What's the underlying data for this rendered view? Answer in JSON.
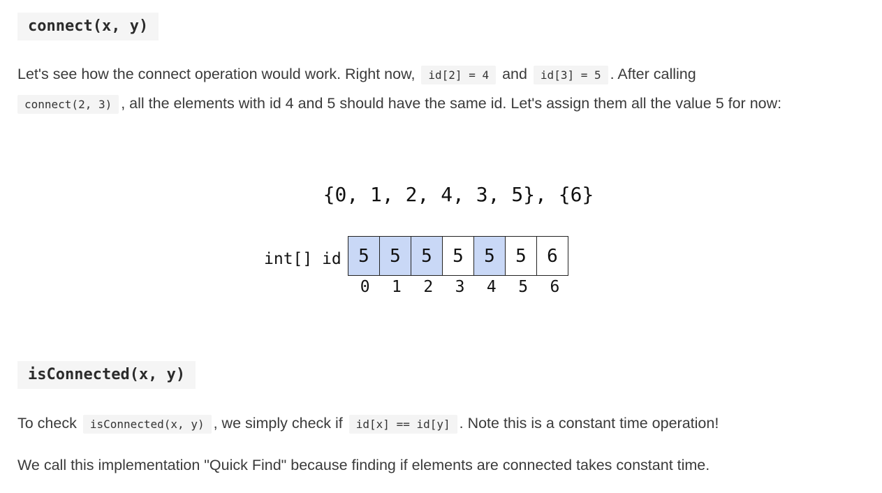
{
  "headings": {
    "connect": "connect(x, y)",
    "is_connected": "isConnected(x, y)"
  },
  "connect_paragraph": {
    "t1": "Let's see how the connect operation would work. Right now, ",
    "c1": "id[2] = 4",
    "t2": " and ",
    "c2": "id[3] = 5",
    "t3": ". After calling ",
    "c3": "connect(2, 3)",
    "t4": ", all the elements with id 4 and 5 should have the same id. Let's assign them all the value 5 for now:"
  },
  "diagram": {
    "sets": "{0, 1, 2, 4, 3, 5}, {6}",
    "array_label": "int[] id",
    "values": [
      "5",
      "5",
      "5",
      "5",
      "5",
      "5",
      "6"
    ],
    "highlighted": [
      true,
      true,
      true,
      false,
      true,
      false,
      false
    ],
    "highlight_color": "#c9d8f6",
    "indices": [
      "0",
      "1",
      "2",
      "3",
      "4",
      "5",
      "6"
    ]
  },
  "check_paragraph": {
    "t1": "To check ",
    "c1": "isConnected(x, y)",
    "t2": ", we simply check if ",
    "c2": "id[x] == id[y]",
    "t3": ". Note this is a constant time operation!"
  },
  "quickfind_paragraph": "We call this implementation \"Quick Find\" because finding if elements are connected takes constant time."
}
